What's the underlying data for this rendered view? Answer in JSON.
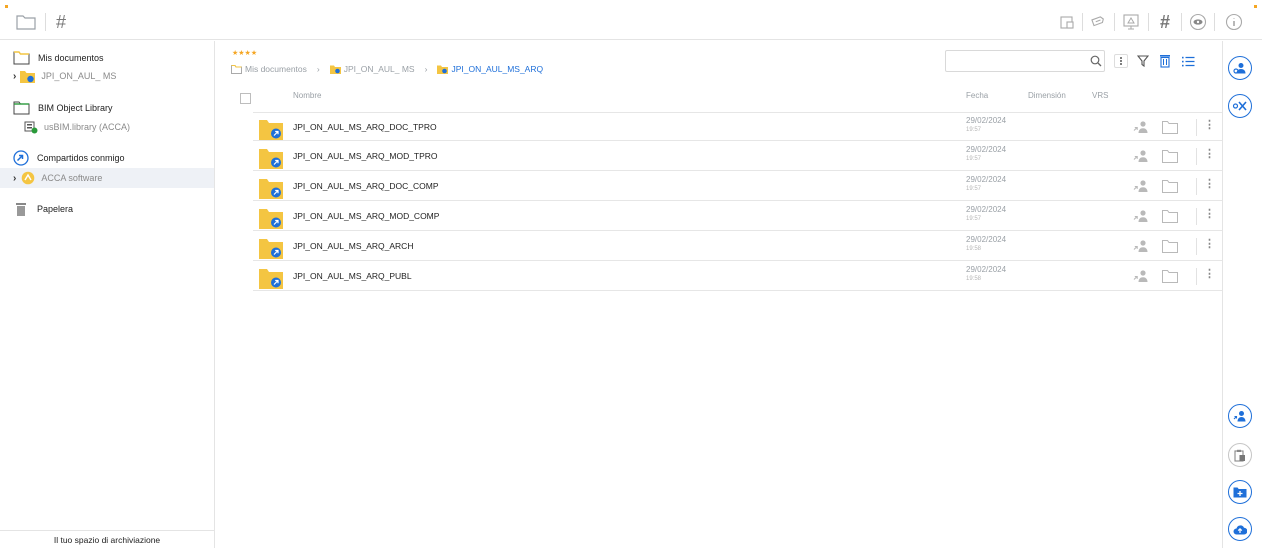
{
  "sidebar": {
    "items": [
      {
        "label": "Mis documentos"
      },
      {
        "label": "JPI_ON_AUL_ MS"
      },
      {
        "label": "BIM Object Library"
      },
      {
        "label": "usBIM.library (ACCA)"
      },
      {
        "label": "Compartidos conmigo"
      },
      {
        "label": "ACCA software"
      },
      {
        "label": "Papelera"
      }
    ],
    "footer": "Il tuo spazio di archiviazione"
  },
  "main": {
    "rating": "★★★★",
    "breadcrumb": [
      "Mis documentos",
      "JPI_ON_AUL_ MS",
      "JPI_ON_AUL_MS_ARQ"
    ],
    "search": {
      "placeholder": "",
      "value": ""
    },
    "columns": {
      "name": "Nombre",
      "date": "Fecha",
      "dimension": "Dimensión",
      "vrs": "VRS"
    },
    "rows": [
      {
        "name": "JPI_ON_AUL_MS_ARQ_DOC_TPRO",
        "date": "29/02/2024",
        "time": "19:57"
      },
      {
        "name": "JPI_ON_AUL_MS_ARQ_MOD_TPRO",
        "date": "29/02/2024",
        "time": "19:57"
      },
      {
        "name": "JPI_ON_AUL_MS_ARQ_DOC_COMP",
        "date": "29/02/2024",
        "time": "19:57"
      },
      {
        "name": "JPI_ON_AUL_MS_ARQ_MOD_COMP",
        "date": "29/02/2024",
        "time": "19:57"
      },
      {
        "name": "JPI_ON_AUL_MS_ARQ_ARCH",
        "date": "29/02/2024",
        "time": "19:58"
      },
      {
        "name": "JPI_ON_AUL_MS_ARQ_PUBL",
        "date": "29/02/2024",
        "time": "19:58"
      }
    ]
  },
  "colors": {
    "accent": "#1e6fd9",
    "folder": "#f4c542",
    "star": "#f5a623",
    "icon_grey": "#9aa0a6"
  },
  "icons": {
    "toolbar_left": [
      "folder-icon",
      "hash-icon"
    ],
    "toolbar_right": [
      "calendar-icon",
      "tag-icon",
      "monitor-icon",
      "hash-icon",
      "eye-icon",
      "info-icon"
    ],
    "header": [
      "search-icon",
      "kebab-icon",
      "filter-icon",
      "trash-icon",
      "list-view-icon"
    ],
    "rail": [
      "user-gear-icon",
      "unlink-icon",
      "share-user-icon",
      "clipboard-icon",
      "new-folder-icon",
      "upload-icon"
    ]
  }
}
